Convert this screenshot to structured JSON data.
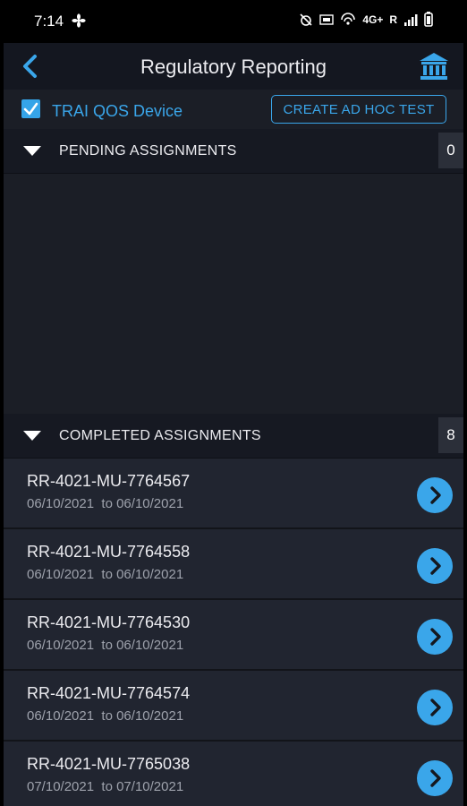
{
  "status_bar": {
    "time": "7:14",
    "network": "4G+",
    "roaming": "R"
  },
  "header": {
    "title": "Regulatory Reporting"
  },
  "device": {
    "label": "TRAI QOS Device",
    "checked": true
  },
  "adhoc_button": {
    "label": "CREATE AD HOC TEST"
  },
  "pending": {
    "title": "PENDING ASSIGNMENTS",
    "count": "0"
  },
  "completed": {
    "title": "COMPLETED ASSIGNMENTS",
    "count": "8",
    "items": [
      {
        "id": "RR-4021-MU-7764567",
        "from": "06/10/2021",
        "to": "06/10/2021"
      },
      {
        "id": "RR-4021-MU-7764558",
        "from": "06/10/2021",
        "to": "06/10/2021"
      },
      {
        "id": "RR-4021-MU-7764530",
        "from": "06/10/2021",
        "to": "06/10/2021"
      },
      {
        "id": "RR-4021-MU-7764574",
        "from": "06/10/2021",
        "to": "06/10/2021"
      },
      {
        "id": "RR-4021-MU-7765038",
        "from": "07/10/2021",
        "to": "07/10/2021"
      }
    ]
  },
  "colors": {
    "accent": "#3aa6ea",
    "background": "#1b1e26",
    "row": "#212530"
  },
  "icons": {
    "back": "chevron-left-icon",
    "bank": "bank-icon",
    "item": "chevron-right-circle-icon",
    "collapse": "triangle-down-icon"
  }
}
